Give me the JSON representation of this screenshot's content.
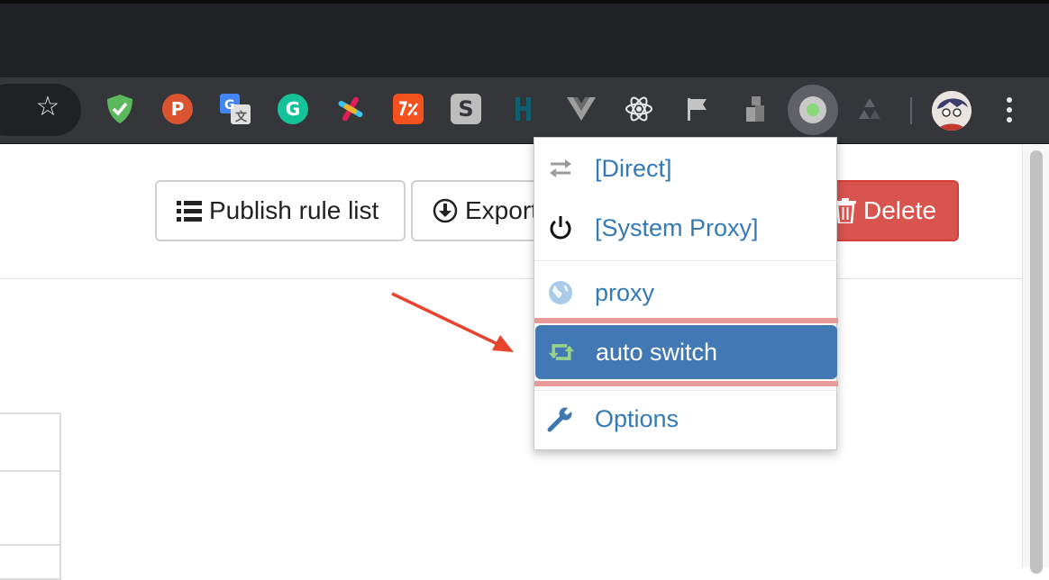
{
  "browser": {
    "toolbar": {
      "bookmark_icon": "star-icon",
      "extensions": [
        {
          "name": "adguard-shield-icon",
          "color": "#5cb85c"
        },
        {
          "name": "producthunt-icon",
          "color": "#da552f",
          "letter": "P"
        },
        {
          "name": "google-translate-icon",
          "color": "#4285f4"
        },
        {
          "name": "grammarly-icon",
          "color": "#15c39a",
          "letter": "G"
        },
        {
          "name": "slack-icon",
          "color": "#e01e5a"
        },
        {
          "name": "postman-icon",
          "color": "#f4511e"
        },
        {
          "name": "s-extension-icon",
          "color": "#bdbdbd",
          "letter": "S"
        },
        {
          "name": "dashlane-icon",
          "color": "#0e353d"
        },
        {
          "name": "vue-devtools-icon",
          "color": "#9e9e9e"
        },
        {
          "name": "react-devtools-icon",
          "color": "#e8eaed"
        },
        {
          "name": "flag-icon",
          "color": "#bdbdbd"
        },
        {
          "name": "blocks-icon",
          "color": "#9e9e9e"
        },
        {
          "name": "switchyomega-icon",
          "color": "#8bd97a"
        },
        {
          "name": "recycle-icon",
          "color": "#5f6368"
        }
      ]
    }
  },
  "page": {
    "actions": {
      "publish_label": "Publish rule list",
      "export_label": "Export",
      "delete_label": "Delete"
    }
  },
  "popup": {
    "items": [
      {
        "label": "[Direct]",
        "icon": "swap-arrows-icon"
      },
      {
        "label": "[System Proxy]",
        "icon": "power-icon"
      },
      {
        "label": "proxy",
        "icon": "globe-icon"
      },
      {
        "label": "auto switch",
        "icon": "retweet-icon",
        "selected": true
      },
      {
        "label": "Options",
        "icon": "wrench-icon"
      }
    ]
  },
  "colors": {
    "link": "#337ab7",
    "selected_bg": "#4279b4",
    "delete_bg": "#d9534f",
    "annotation_arrow": "#e8432d"
  }
}
